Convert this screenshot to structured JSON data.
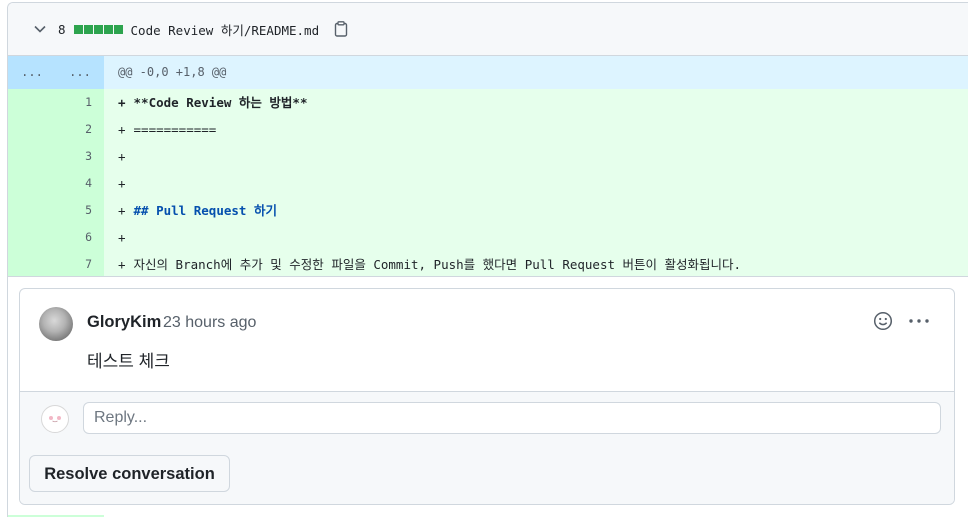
{
  "file": {
    "changes_count": "8",
    "diffstat_blocks": 5,
    "path": "Code Review 하기/README.md"
  },
  "hunk": {
    "old_marker": "...",
    "new_marker": "...",
    "header": "@@ -0,0 +1,8 @@"
  },
  "lines": [
    {
      "num": "1",
      "text": "**Code Review 하는 방법**"
    },
    {
      "num": "2",
      "text": "==========="
    },
    {
      "num": "3",
      "text": ""
    },
    {
      "num": "4",
      "text": ""
    },
    {
      "num": "5",
      "text": "## Pull Request 하기"
    },
    {
      "num": "6",
      "text": ""
    },
    {
      "num": "7",
      "text": "자신의 Branch에 추가 및 수정한 파일을 Commit, Push를 했다면 Pull Request 버튼이 활성화됩니다."
    }
  ],
  "add_marker": "+",
  "comment": {
    "author": "GloryKim",
    "time": "23 hours ago",
    "body": "테스트 체크"
  },
  "reply": {
    "placeholder": "Reply..."
  },
  "resolve_label": "Resolve conversation",
  "colors": {
    "added_line_bg": "#e6ffec",
    "added_gutter_bg": "#ccffd8",
    "hunk_bg": "#ddf4ff",
    "diffstat_green": "#2da44e",
    "heading_blue": "#0550ae"
  },
  "icons": {
    "collapse": "chevron-down-icon",
    "copy": "copy-icon",
    "emoji": "smiley-icon",
    "more": "kebab-horizontal-icon"
  }
}
